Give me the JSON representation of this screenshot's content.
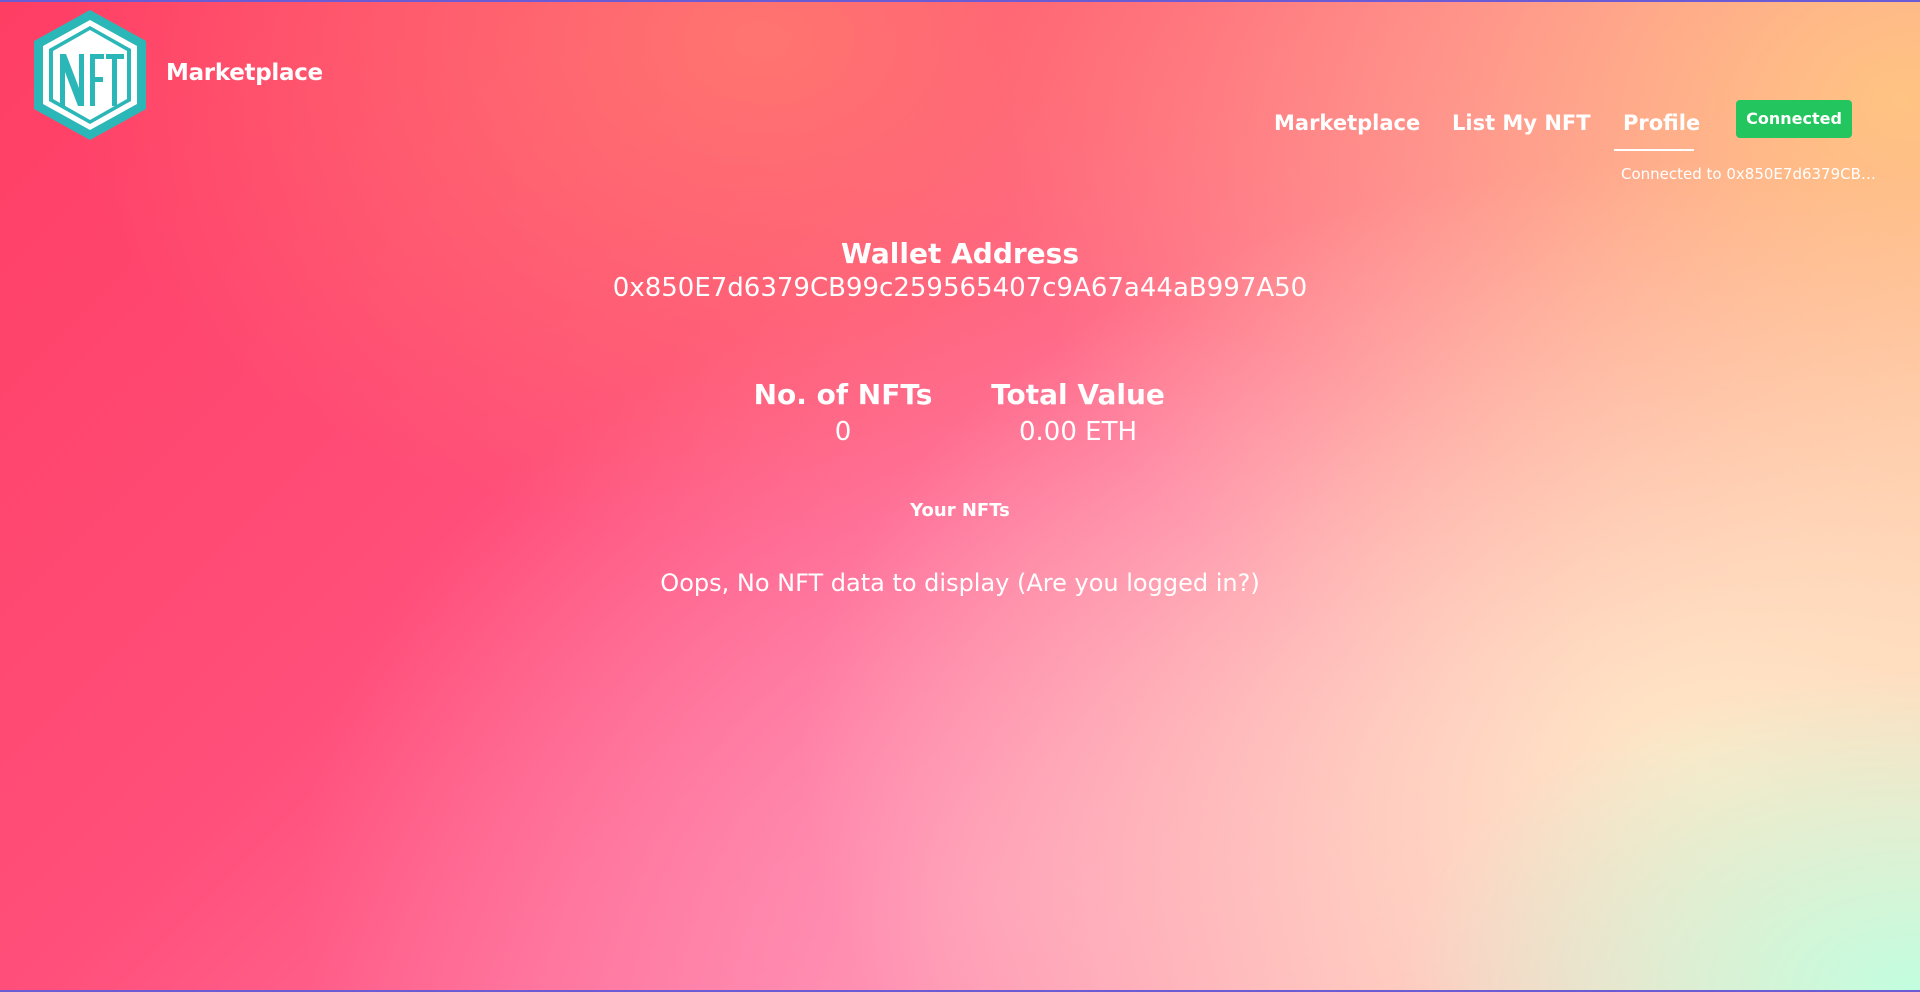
{
  "header": {
    "brand": "Marketplace"
  },
  "nav": {
    "items": [
      {
        "label": "Marketplace"
      },
      {
        "label": "List My NFT"
      },
      {
        "label": "Profile"
      }
    ],
    "active": "Profile"
  },
  "wallet_button": {
    "label": "Connected"
  },
  "connection_status": "Connected to 0x850E7d6379CB9...",
  "profile": {
    "wallet_heading": "Wallet Address",
    "wallet_address": "0x850E7d6379CB99c259565407c9A67a44aB997A50",
    "stats": {
      "nft_count_label": "No. of NFTs",
      "nft_count_value": "0",
      "total_value_label": "Total Value",
      "total_value_value": "0.00 ETH"
    },
    "your_nfts_heading": "Your NFTs",
    "empty_message": "Oops, No NFT data to display (Are you logged in?)"
  },
  "icons": {
    "logo": "nft-hexagon-logo"
  },
  "colors": {
    "button_green": "#22c55e",
    "logo_teal": "#2bb6b8",
    "logo_fill": "#ffffff"
  }
}
